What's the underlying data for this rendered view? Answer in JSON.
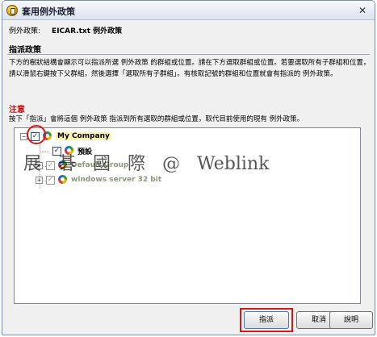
{
  "window": {
    "title": "套用例外政策",
    "close_glyph": "✕"
  },
  "policy": {
    "label": "例外政策:",
    "value": "EICAR.txt 例外政策"
  },
  "assign_section": {
    "title": "指派政策",
    "description": "下方的樹狀結構會顯示可以指派所選 例外政策 的群組或位置。請在下方選取群組或位置。若要選取所有子群組和位置，請以滑鼠右鍵按下父群組，然後選擇「選取所有子群組」。有核取記號的群組和位置就會有指派的 例外政策。"
  },
  "note": {
    "title": "注意",
    "text": "按下「指派」會將這個 例外政策 指派到所有選取的群組或位置，取代目前使用的現有 例外政策。"
  },
  "tree": {
    "root": {
      "expander": "−",
      "check": "✓",
      "label": "My Company"
    },
    "children": [
      {
        "expander": "",
        "check": "✓",
        "label": "預設"
      },
      {
        "expander": "+",
        "check": "✓",
        "label": "Default Group"
      },
      {
        "expander": "+",
        "check": "✓",
        "label": "windows server 32 bit"
      }
    ]
  },
  "watermark": "展 碁 國 際 @ Weblink",
  "buttons": {
    "assign": "指派",
    "cancel": "取消",
    "help": "說明"
  }
}
